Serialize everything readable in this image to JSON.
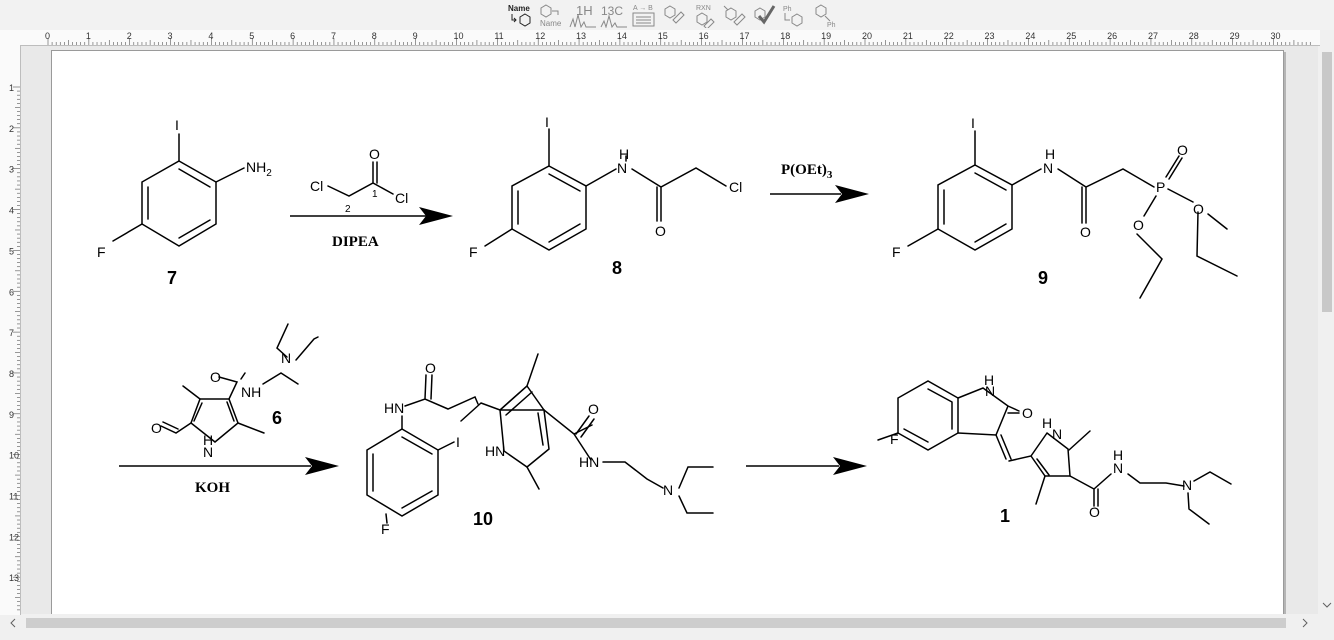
{
  "toolbar": {
    "tools": [
      {
        "name": "name-to-structure-icon",
        "label": "Name"
      },
      {
        "name": "structure-to-name-icon",
        "label": "Name"
      },
      {
        "name": "predict-1h-nmr-icon",
        "label": "1H"
      },
      {
        "name": "predict-13c-nmr-icon",
        "label": "13C"
      },
      {
        "name": "reaction-text-icon",
        "label": "A → B"
      },
      {
        "name": "clean-structure-icon",
        "label": ""
      },
      {
        "name": "reaction-rxn-icon",
        "label": "RXN"
      },
      {
        "name": "map-atoms-icon",
        "label": ""
      },
      {
        "name": "check-structure-icon",
        "label": ""
      },
      {
        "name": "expand-label-icon",
        "label": "Ph"
      },
      {
        "name": "contract-label-icon",
        "label": "Ph"
      }
    ]
  },
  "ruler": {
    "top_labels": [
      "0",
      "1",
      "2",
      "3",
      "4",
      "5",
      "6",
      "7",
      "8",
      "9",
      "10",
      "11",
      "12",
      "13",
      "14",
      "15",
      "16",
      "17",
      "18",
      "19",
      "20",
      "21",
      "22",
      "23",
      "24",
      "25",
      "26",
      "27",
      "28",
      "29",
      "30"
    ],
    "left_labels": [
      "1",
      "2",
      "3",
      "4",
      "5",
      "6",
      "7",
      "8",
      "9",
      "10",
      "11",
      "12",
      "13"
    ]
  },
  "scheme": {
    "compounds": [
      {
        "id": "7",
        "atoms": {
          "iodo": "I",
          "amine": "NH2",
          "fluoro": "F"
        }
      },
      {
        "id": "8",
        "atoms": {
          "iodo": "I",
          "nh": "H",
          "n": "N",
          "carbonyl_o": "O",
          "chloro": "Cl",
          "fluoro": "F"
        }
      },
      {
        "id": "9",
        "atoms": {
          "iodo": "I",
          "nh": "H",
          "n": "N",
          "carbonyl_o": "O",
          "phosphorus": "P",
          "p_oxo": "O",
          "ester_o1": "O",
          "ester_o2": "O",
          "fluoro": "F"
        }
      },
      {
        "id": "6",
        "atoms": {
          "carbonyl_o": "O",
          "amide_nh": "NH",
          "amine_n": "N",
          "aldehyde_o": "O",
          "pyrrole_n": "N",
          "pyrrole_h": "H"
        }
      },
      {
        "id": "10",
        "atoms": {
          "amide_hn": "HN",
          "amide_o": "O",
          "iodo": "I",
          "fluoro": "F",
          "pyrrole_hn": "HN",
          "amide2_o": "O",
          "amide2_hn": "HN",
          "amine_n": "N"
        }
      },
      {
        "id": "1",
        "atoms": {
          "lactam_nh": "H",
          "lactam_n": "N",
          "lactam_o": "O",
          "fluoro": "F",
          "pyrrole_h": "H",
          "pyrrole_n": "N",
          "amide_h": "H",
          "amide_n": "N",
          "amide_o": "O",
          "amine_n": "N"
        }
      }
    ],
    "reagent": {
      "chloro_left": "Cl",
      "carbonyl_o": "O",
      "chloro_right": "Cl",
      "atom_number_1": "1",
      "atom_number_2": "2"
    },
    "arrows": [
      {
        "below": "DIPEA",
        "above": ""
      },
      {
        "above": "P(OEt)",
        "above_sub": "3",
        "below": ""
      },
      {
        "below": "KOH",
        "above": ""
      },
      {
        "above": "",
        "below": ""
      }
    ]
  },
  "scroll": {
    "left_arrow": "<",
    "right_arrow": ">",
    "up_arrow": "^",
    "down_arrow": "v"
  }
}
